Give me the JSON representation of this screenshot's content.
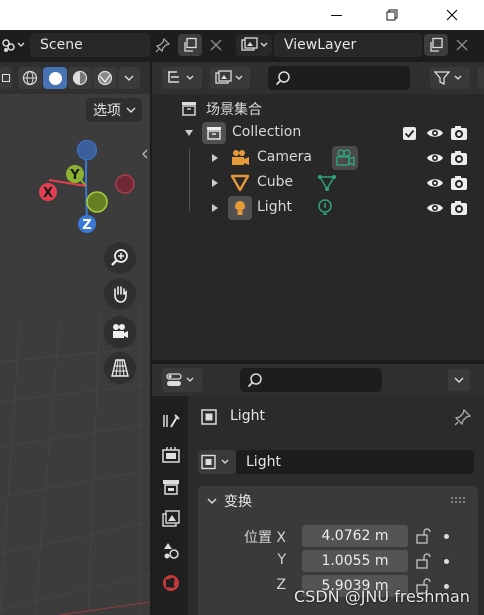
{
  "topbar": {
    "scene_value": "Scene",
    "view_layer_value": "ViewLayer"
  },
  "viewport": {
    "view_menu_value": "选项",
    "gizmo": {
      "x_label": "X",
      "y_label": "Y",
      "z_label": "Z"
    }
  },
  "outliner": {
    "scene_collection_label": "场景集合",
    "collection_label": "Collection",
    "items": [
      {
        "label": "Camera"
      },
      {
        "label": "Cube"
      },
      {
        "label": "Light"
      }
    ]
  },
  "properties": {
    "object_name": "Light",
    "data_name": "Light",
    "transform_panel_label": "变换",
    "location_label": "位置 X",
    "y_label": "Y",
    "z_label": "Z",
    "location_x": "4.0762 m",
    "location_y": "1.0055 m",
    "location_z": "5.9039 m"
  },
  "watermark": "CSDN @JNU freshman",
  "colors": {
    "x_axis": "#e2404f",
    "y_axis": "#8bb332",
    "z_axis": "#3a78d6",
    "active_toggle": "#4772b3",
    "object_green": "#2fa37e"
  }
}
